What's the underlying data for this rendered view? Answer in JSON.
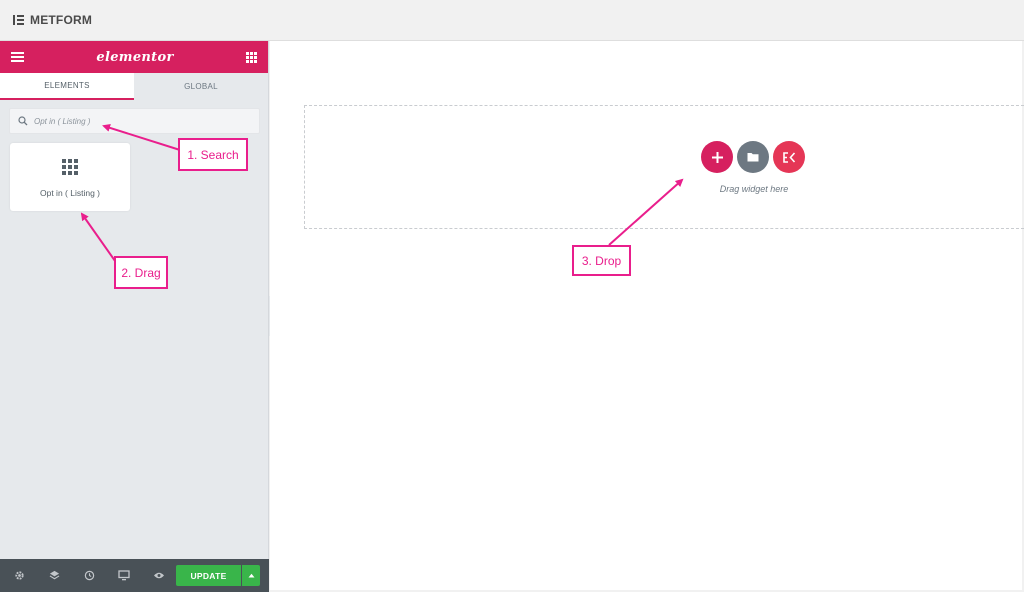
{
  "app": {
    "title": "METFORM"
  },
  "panel": {
    "brand": "elementor",
    "tabs": [
      {
        "label": "ELEMENTS",
        "active": true
      },
      {
        "label": "GLOBAL",
        "active": false
      }
    ],
    "search": {
      "value": "Opt in ( Listing )"
    },
    "widgets": [
      {
        "label": "Opt in ( Listing )"
      }
    ],
    "footer": {
      "update_label": "UPDATE"
    }
  },
  "canvas": {
    "drag_text": "Drag widget here"
  },
  "annotations": {
    "search": "1. Search",
    "drag": "2. Drag",
    "drop": "3. Drop"
  },
  "colors": {
    "accent": "#d6205f",
    "annotation": "#e91e8c",
    "update": "#39b54a",
    "footer": "#495157"
  }
}
